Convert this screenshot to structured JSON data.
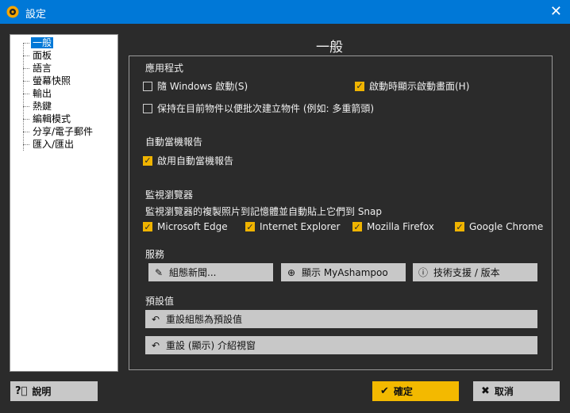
{
  "window": {
    "title": "設定",
    "close_icon": "✕"
  },
  "tree": {
    "items": [
      {
        "label": "一般",
        "selected": true
      },
      {
        "label": "面板"
      },
      {
        "label": "語言"
      },
      {
        "label": "螢幕快照"
      },
      {
        "label": "輸出"
      },
      {
        "label": "熱鍵"
      },
      {
        "label": "編輯模式"
      },
      {
        "label": "分享/電子郵件"
      },
      {
        "label": "匯入/匯出"
      }
    ]
  },
  "page": {
    "title": "一般"
  },
  "app_group": {
    "label": "應用程式",
    "start_windows": {
      "label": "隨 Windows 啟動(S)",
      "checked": false
    },
    "show_splash": {
      "label": "啟動時顯示啟動畫面(H)",
      "checked": true
    },
    "keep_objects": {
      "label": "保持在目前物件以便批次建立物件 (例如: 多重箭頭)",
      "checked": false
    }
  },
  "crash_group": {
    "label": "自動當機報告",
    "enable_crash": {
      "label": "啟用自動當機報告",
      "checked": true
    }
  },
  "browser_group": {
    "label": "監視瀏覽器",
    "desc": "監視瀏覽器的複製照片到記憶體並自動貼上它們到 Snap",
    "edge": {
      "label": "Microsoft Edge",
      "checked": true
    },
    "ie": {
      "label": "Internet Explorer",
      "checked": true
    },
    "firefox": {
      "label": "Mozilla Firefox",
      "checked": true
    },
    "chrome": {
      "label": "Google Chrome",
      "checked": true
    }
  },
  "service_group": {
    "label": "服務",
    "news_btn": "組態新聞...",
    "myashampoo_btn": "顯示 MyAshampoo",
    "support_btn": "技術支援 / 版本"
  },
  "defaults_group": {
    "label": "預設值",
    "reset_config_btn": "重設組態為預設值",
    "reset_intro_btn": "重設 (顯示) 介紹視窗"
  },
  "footer": {
    "help_btn": "說明",
    "ok_btn": "確定",
    "cancel_btn": "取消"
  },
  "colors": {
    "accent": "#0078d7",
    "check": "#f0b400",
    "ok": "#f3b900",
    "background": "#2b2b2b"
  }
}
